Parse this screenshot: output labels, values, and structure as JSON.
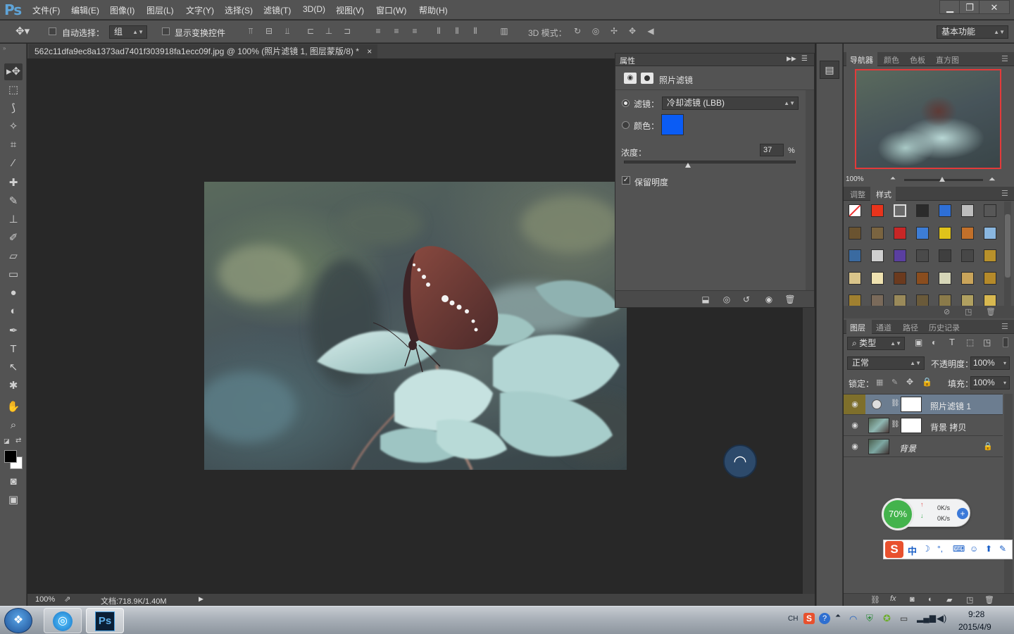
{
  "app": {
    "logo": "Ps",
    "menu": [
      "文件(F)",
      "编辑(E)",
      "图像(I)",
      "图层(L)",
      "文字(Y)",
      "选择(S)",
      "滤镜(T)",
      "3D(D)",
      "视图(V)",
      "窗口(W)",
      "帮助(H)"
    ],
    "window_controls": [
      "▁",
      "❐",
      "✕"
    ]
  },
  "options": {
    "auto_select_label": "自动选择：",
    "auto_select_value": "组",
    "show_transform_label": "显示变换控件",
    "mode_3d_label": "3D 模式：",
    "workspace": "基本功能"
  },
  "document": {
    "tab_title": "562c11dfa9ec8a1373ad7401f303918fa1ecc09f.jpg @ 100% (照片滤镜 1, 图层蒙版/8) *",
    "tab_close": "×",
    "zoom": "100%",
    "doc_info": "文档:718.9K/1.40M"
  },
  "properties": {
    "panel_title": "属性",
    "adjustment_title": "照片滤镜",
    "filter_label": "滤镜：",
    "filter_value": "冷却滤镜 (LBB)",
    "color_label": "颜色：",
    "color_value": "#0a5cf5",
    "density_label": "浓度：",
    "density_value": "37",
    "density_unit": "%",
    "density_fraction": 0.37,
    "preserve_label": "保留明度",
    "preserve_checked": true
  },
  "navigator": {
    "tabs": [
      "导航器",
      "颜色",
      "色板",
      "直方图"
    ],
    "zoom": "100%"
  },
  "styles_panel": {
    "tabs": [
      "调整",
      "样式"
    ]
  },
  "layers": {
    "tabs": [
      "图层",
      "通道",
      "路径",
      "历史记录"
    ],
    "kind_label": "类型",
    "blend_mode": "正常",
    "opacity_label": "不透明度：",
    "opacity_value": "100%",
    "lock_label": "锁定：",
    "fill_label": "填充：",
    "fill_value": "100%",
    "items": [
      {
        "name": "照片滤镜 1",
        "selected": true
      },
      {
        "name": "背景 拷贝",
        "selected": false
      },
      {
        "name": "背景",
        "selected": false
      }
    ]
  },
  "widgets": {
    "net_percent": "70%",
    "up_speed": "0K/s",
    "down_speed": "0K/s"
  },
  "taskbar": {
    "lang": "CH",
    "time": "9:28",
    "date": "2015/4/9"
  }
}
